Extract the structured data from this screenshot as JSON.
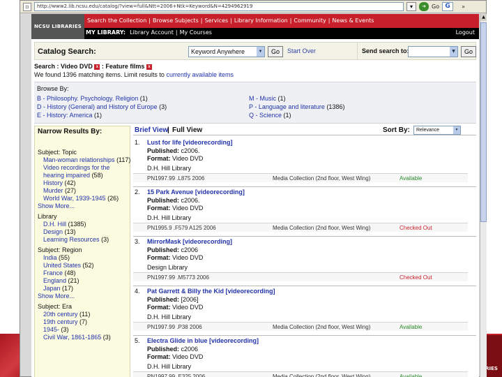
{
  "browser": {
    "url": "http://www2.lib.ncsu.edu/catalog/?view=full&Ntt=2006+Ntk=Keyword&N=4294962919",
    "go_label": "Go",
    "go_icon": "green-go-arrow",
    "search_engine": "G",
    "more": "»"
  },
  "header": {
    "logo": "NCSU LIBRARIES",
    "main_nav": [
      "Search the Collection",
      "Browse Subjects",
      "Services",
      "Library Information",
      "Community",
      "News & Events"
    ],
    "sub_nav": [
      "MY LIBRARY:",
      "Library Account",
      "My Courses"
    ],
    "logout": "Logout"
  },
  "search": {
    "label": "Catalog Search:",
    "field_value": "",
    "scope_value": "Keyword Anywhere",
    "go_label": "Go",
    "start_over": "Start Over",
    "send_label": "Send search to:",
    "send_value": "",
    "send_go_label": "Go"
  },
  "breadcrumb": {
    "prefix": "Search : Video DVD",
    "filter": ": Feature films",
    "remove_icon": "x"
  },
  "matching": {
    "prefix": "We found 1396 matching items. Limit results to",
    "link": "currently available items"
  },
  "browse": {
    "title": "Browse By:",
    "col1": [
      {
        "label": "B - Philosophy. Psychology. Religion",
        "count": "(1)"
      },
      {
        "label": "D - History (General) and History of Europe",
        "count": "(3)"
      },
      {
        "label": "E - History: America",
        "count": "(1)"
      }
    ],
    "col2": [
      {
        "label": "M - Music",
        "count": "(1)"
      },
      {
        "label": "P - Language and literature",
        "count": "(1386)"
      },
      {
        "label": "Q - Science",
        "count": "(1)"
      }
    ]
  },
  "narrow": {
    "title": "Narrow Results By:",
    "groups": [
      {
        "heading": "Subject: Topic",
        "items": [
          {
            "label": "Man-woman relationships",
            "count": "(117)"
          },
          {
            "label": "Video recordings for the hearing impaired",
            "count": "(58)"
          },
          {
            "label": "History",
            "count": "(42)"
          },
          {
            "label": "Murder",
            "count": "(27)"
          },
          {
            "label": "World War, 1939-1945",
            "count": "(26)"
          }
        ],
        "more": "Show More..."
      },
      {
        "heading": "Library",
        "items": [
          {
            "label": "D.H. Hill",
            "count": "(1385)"
          },
          {
            "label": "Design",
            "count": "(13)"
          },
          {
            "label": "Learning Resources",
            "count": "(3)"
          }
        ],
        "more": ""
      },
      {
        "heading": "Subject: Region",
        "items": [
          {
            "label": "India",
            "count": "(55)"
          },
          {
            "label": "United States",
            "count": "(52)"
          },
          {
            "label": "France",
            "count": "(48)"
          },
          {
            "label": "England",
            "count": "(21)"
          },
          {
            "label": "Japan",
            "count": "(17)"
          }
        ],
        "more": "Show More..."
      },
      {
        "heading": "Subject: Era",
        "items": [
          {
            "label": "20th century",
            "count": "(11)"
          },
          {
            "label": "19th century",
            "count": "(7)"
          },
          {
            "label": "1945-",
            "count": "(3)"
          },
          {
            "label": "Civil War, 1861-1865",
            "count": "(3)"
          }
        ],
        "more": ""
      }
    ]
  },
  "results_toolbar": {
    "brief": "Brief View",
    "separator": "|",
    "full": "Full View",
    "sort_label": "Sort By:",
    "sort_value": "Relevance"
  },
  "results": [
    {
      "num": "1.",
      "title": "Lust for life [videorecording]",
      "published_label": "Published:",
      "published": "c2006.",
      "format_label": "Format:",
      "format": "Video DVD",
      "library": "D.H. Hill Library",
      "call": "PN1997.99 .L875 2006",
      "location": "Media Collection (2nd floor, West Wing)",
      "status": "Available",
      "status_type": "avail"
    },
    {
      "num": "2.",
      "title": "15 Park Avenue [videorecording]",
      "published_label": "Published:",
      "published": "c2006.",
      "format_label": "Format:",
      "format": "Video DVD",
      "library": "D.H. Hill Library",
      "call": "PN1995.9 .F579 A125 2006",
      "location": "Media Collection (2nd floor, West Wing)",
      "status": "Checked Out",
      "status_type": "out"
    },
    {
      "num": "3.",
      "title": "MirrorMask [videorecording]",
      "published_label": "Published:",
      "published": "c2006",
      "format_label": "Format:",
      "format": "Video DVD",
      "library": "Design Library",
      "call": "PN1997.99 .M5773 2006",
      "location": "",
      "status": "Checked Out",
      "status_type": "out"
    },
    {
      "num": "4.",
      "title": "Pat Garrett & Billy the Kid [videorecording]",
      "published_label": "Published:",
      "published": "[2006]",
      "format_label": "Format:",
      "format": "Video DVD",
      "library": "D.H. Hill Library",
      "call": "PN1997.99 .P38 2006",
      "location": "Media Collection (2nd floor, West Wing)",
      "status": "Available",
      "status_type": "avail"
    },
    {
      "num": "5.",
      "title": "Electra Glide in blue [videorecording]",
      "published_label": "Published:",
      "published": "c2006",
      "format_label": "Format:",
      "format": "Video DVD",
      "library": "D.H. Hill Library",
      "call": "PN1997.99 .E325 2006",
      "location": "Media Collection (2nd floor, West Wing)",
      "status": "Available",
      "status_type": "avail"
    }
  ],
  "slide": {
    "logo_text": "RIES"
  },
  "colors": {
    "brand_red": "#c8202a",
    "link_blue": "#2233aa",
    "available_green": "#2a8a2a"
  }
}
